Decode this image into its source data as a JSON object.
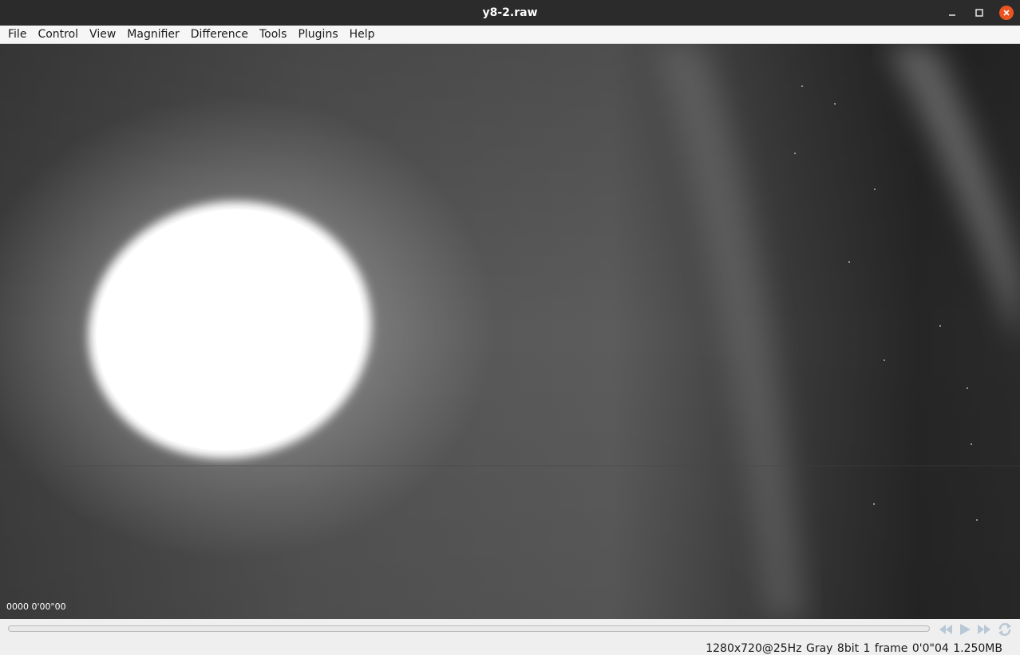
{
  "window": {
    "title": "y8-2.raw",
    "controls": [
      "minimize-icon",
      "maximize-icon",
      "close-icon"
    ]
  },
  "menu": {
    "items": [
      "File",
      "Control",
      "View",
      "Magnifier",
      "Difference",
      "Tools",
      "Plugins",
      "Help"
    ]
  },
  "viewport": {
    "frame_overlay": "0000  0'00\"00"
  },
  "controls": {
    "icons": [
      "rewind-icon",
      "play-icon",
      "fast-forward-icon",
      "loop-icon"
    ],
    "accent_color": "#b9c8d6"
  },
  "status": {
    "text": "1280x720@25Hz Gray  8bit  1 frame  0'0\"04  1.250MB"
  }
}
